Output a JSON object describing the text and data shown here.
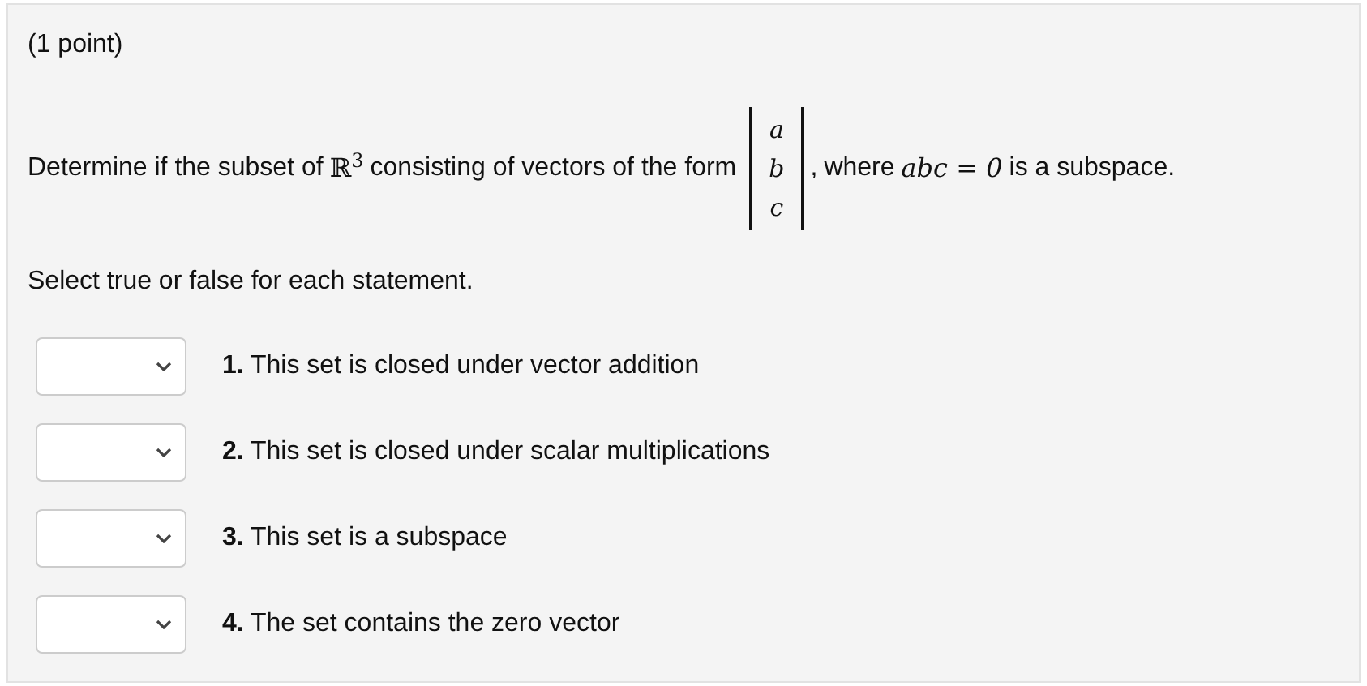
{
  "points": "(1 point)",
  "question": {
    "intro": "Determine if the subset of",
    "space": "ℝ$^{3}$",
    "middle": "consisting of vectors of the form",
    "vector": [
      "a",
      "b",
      "c"
    ],
    "comma": ",",
    "where": "where",
    "condition": "abc = 0",
    "ending": "is a subspace."
  },
  "instruction": "Select true or false for each statement.",
  "statements": [
    {
      "text": "**1.** This set is closed under vector addition"
    },
    {
      "text": "**2.** This set is closed under scalar multiplications"
    },
    {
      "text": "**3.** This set is a subspace"
    },
    {
      "text": "**4.** The set contains the zero vector"
    }
  ]
}
